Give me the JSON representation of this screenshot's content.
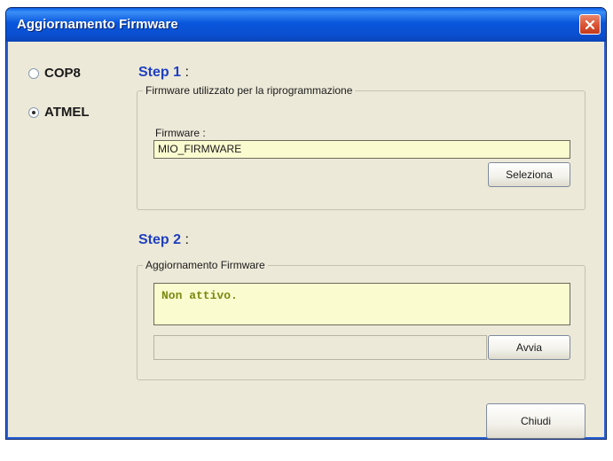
{
  "window": {
    "title": "Aggiornamento Firmware"
  },
  "chip_options": [
    {
      "label": "COP8",
      "selected": false
    },
    {
      "label": "ATMEL",
      "selected": true
    }
  ],
  "step1": {
    "title": "Step 1",
    "colon": ":",
    "group_title": "Firmware utilizzato per la riprogrammazione",
    "field_label": "Firmware :",
    "field_value": "MIO_FIRMWARE",
    "select_button": "Seleziona"
  },
  "step2": {
    "title": "Step 2",
    "colon": ":",
    "group_title": "Aggiornamento Firmware",
    "status_text": "Non attivo.",
    "progress": 0,
    "start_button": "Avvia"
  },
  "footer": {
    "close_button": "Chiudi"
  },
  "colors": {
    "title_bar": "#0856dc",
    "close_button": "#d8502f",
    "step_heading": "#1f3fbf",
    "input_background": "#fbfbd0",
    "status_text": "#7a8a10"
  },
  "icons": {
    "close": "close-x-icon"
  }
}
